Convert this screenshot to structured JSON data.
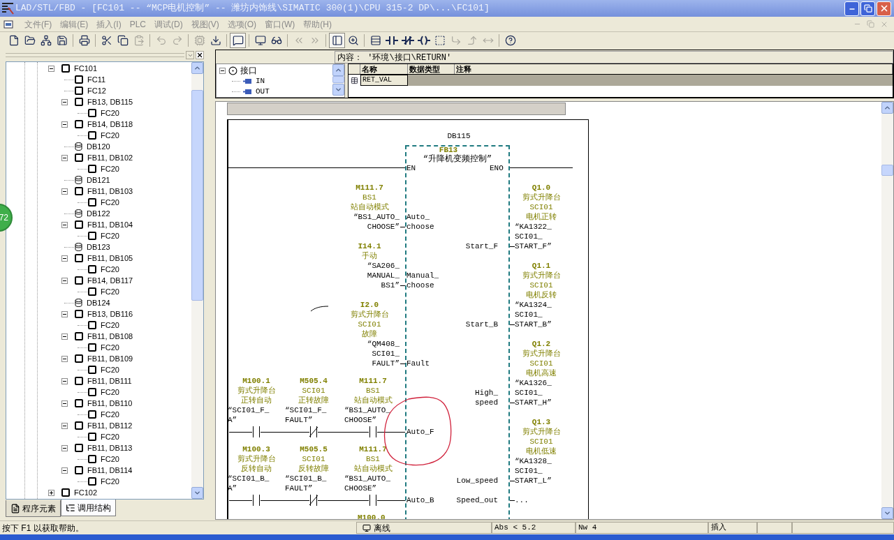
{
  "window": {
    "title": "LAD/STL/FBD  - [FC101 -- “MCP电机控制” -- 潍坊内饰线\\SIMATIC 300(1)\\CPU 315-2 DP\\...\\FC101]"
  },
  "menu": [
    "文件(F)",
    "编辑(E)",
    "插入(I)",
    "PLC",
    "调试(D)",
    "视图(V)",
    "选项(O)",
    "窗口(W)",
    "帮助(H)"
  ],
  "toolbar": [
    [
      {
        "kind": "new",
        "disabled": false,
        "pressed": false
      },
      {
        "kind": "open",
        "disabled": false,
        "pressed": false
      },
      {
        "kind": "nodes",
        "disabled": false,
        "pressed": false
      },
      {
        "kind": "save",
        "disabled": false,
        "pressed": false
      }
    ],
    [
      {
        "kind": "print",
        "disabled": false,
        "pressed": false
      }
    ],
    [
      {
        "kind": "cut",
        "disabled": false,
        "pressed": false
      },
      {
        "kind": "copy",
        "disabled": false,
        "pressed": false
      },
      {
        "kind": "paste",
        "disabled": true,
        "pressed": false
      }
    ],
    [
      {
        "kind": "undo",
        "disabled": true,
        "pressed": false
      },
      {
        "kind": "redo",
        "disabled": true,
        "pressed": false
      }
    ],
    [
      {
        "kind": "compile",
        "disabled": true,
        "pressed": false
      },
      {
        "kind": "download",
        "disabled": false,
        "pressed": false
      }
    ],
    [
      {
        "kind": "overview",
        "disabled": false,
        "pressed": true
      }
    ],
    [
      {
        "kind": "monitor",
        "disabled": false,
        "pressed": false
      },
      {
        "kind": "glasses",
        "disabled": false,
        "pressed": false
      }
    ],
    [
      {
        "kind": "prev",
        "disabled": true,
        "pressed": false
      },
      {
        "kind": "next",
        "disabled": true,
        "pressed": false
      }
    ],
    [
      {
        "kind": "panel",
        "disabled": false,
        "pressed": true
      },
      {
        "kind": "zoom",
        "disabled": false,
        "pressed": false
      }
    ],
    [
      {
        "kind": "network",
        "disabled": false,
        "pressed": false
      },
      {
        "kind": "no",
        "disabled": false,
        "pressed": false
      },
      {
        "kind": "nc",
        "disabled": false,
        "pressed": false
      },
      {
        "kind": "coil",
        "disabled": false,
        "pressed": false
      },
      {
        "kind": "box",
        "disabled": false,
        "pressed": false
      },
      {
        "kind": "branch-open",
        "disabled": true,
        "pressed": false
      },
      {
        "kind": "branch-close",
        "disabled": true,
        "pressed": false
      },
      {
        "kind": "branch-span",
        "disabled": true,
        "pressed": false
      }
    ],
    [
      {
        "kind": "help",
        "disabled": false,
        "pressed": false
      }
    ]
  ],
  "call_tree": [
    {
      "label": "FC101",
      "kind": "block",
      "expanded": true,
      "children": [
        {
          "label": "FC11",
          "kind": "block"
        },
        {
          "label": "FC12",
          "kind": "block"
        },
        {
          "label": "FB13, DB115",
          "kind": "block",
          "expanded": true,
          "children": [
            {
              "label": "FC20",
              "kind": "block"
            }
          ]
        },
        {
          "label": "FB14, DB118",
          "kind": "block",
          "expanded": true,
          "children": [
            {
              "label": "FC20",
              "kind": "block"
            }
          ]
        },
        {
          "label": "DB120",
          "kind": "db"
        },
        {
          "label": "FB11, DB102",
          "kind": "block",
          "expanded": true,
          "children": [
            {
              "label": "FC20",
              "kind": "block"
            }
          ]
        },
        {
          "label": "DB121",
          "kind": "db"
        },
        {
          "label": "FB11, DB103",
          "kind": "block",
          "expanded": true,
          "children": [
            {
              "label": "FC20",
              "kind": "block"
            }
          ]
        },
        {
          "label": "DB122",
          "kind": "db"
        },
        {
          "label": "FB11, DB104",
          "kind": "block",
          "expanded": true,
          "children": [
            {
              "label": "FC20",
              "kind": "block"
            }
          ]
        },
        {
          "label": "DB123",
          "kind": "db"
        },
        {
          "label": "FB11, DB105",
          "kind": "block",
          "expanded": true,
          "children": [
            {
              "label": "FC20",
              "kind": "block"
            }
          ]
        },
        {
          "label": "FB14, DB117",
          "kind": "block",
          "expanded": true,
          "children": [
            {
              "label": "FC20",
              "kind": "block"
            }
          ]
        },
        {
          "label": "DB124",
          "kind": "db"
        },
        {
          "label": "FB13, DB116",
          "kind": "block",
          "expanded": true,
          "children": [
            {
              "label": "FC20",
              "kind": "block"
            }
          ]
        },
        {
          "label": "FB11, DB108",
          "kind": "block",
          "expanded": true,
          "children": [
            {
              "label": "FC20",
              "kind": "block"
            }
          ]
        },
        {
          "label": "FB11, DB109",
          "kind": "block",
          "expanded": true,
          "children": [
            {
              "label": "FC20",
              "kind": "block"
            }
          ]
        },
        {
          "label": "FB11, DB111",
          "kind": "block",
          "expanded": true,
          "children": [
            {
              "label": "FC20",
              "kind": "block"
            }
          ]
        },
        {
          "label": "FB11, DB110",
          "kind": "block",
          "expanded": true,
          "children": [
            {
              "label": "FC20",
              "kind": "block"
            }
          ]
        },
        {
          "label": "FB11, DB112",
          "kind": "block",
          "expanded": true,
          "children": [
            {
              "label": "FC20",
              "kind": "block"
            }
          ]
        },
        {
          "label": "FB11, DB113",
          "kind": "block",
          "expanded": true,
          "children": [
            {
              "label": "FC20",
              "kind": "block"
            }
          ]
        },
        {
          "label": "FB11, DB114",
          "kind": "block",
          "expanded": true,
          "children": [
            {
              "label": "FC20",
              "kind": "block"
            }
          ]
        }
      ]
    },
    {
      "label": "FC102",
      "kind": "block",
      "expanded": false
    }
  ],
  "left_tabs": [
    {
      "label": "程序元素",
      "selected": false
    },
    {
      "label": "调用结构",
      "selected": true
    }
  ],
  "floating_badge": "72",
  "interface": {
    "content": "内容： '环境\\接口\\RETURN'",
    "tree": {
      "label": "接口",
      "expanded": true,
      "children": [
        "IN",
        "OUT"
      ]
    },
    "columns": [
      "名称",
      "数据类型",
      "注释"
    ],
    "rows": [
      [
        "RET_VAL"
      ]
    ]
  },
  "network": {
    "instance": "DB115",
    "block": "FB13",
    "block_name": "“升降机变频控制”",
    "en": "EN",
    "eno": "ENO",
    "inputs": [
      {
        "pin": [
          "Auto_",
          "choose"
        ],
        "address": "M111.7",
        "comment": [
          "BS1",
          "站自动模式"
        ],
        "symbol": [
          "“BS1_AUTO_",
          "CHOOSE”"
        ]
      },
      {
        "pin": [
          "Manual_",
          "choose"
        ],
        "address": "I14.1",
        "comment": [
          "手动"
        ],
        "symbol": [
          "“SA206_",
          "MANUAL_",
          "BS1”"
        ]
      },
      {
        "pin": [
          "Fault"
        ],
        "address": "I2.0",
        "comment": [
          "剪式升降台",
          "SCI01",
          "故障"
        ],
        "symbol": [
          "“QM408_",
          "SCI01_",
          "FAULT”"
        ]
      }
    ],
    "contact_rows": [
      {
        "pin": "Auto_F",
        "contacts": [
          {
            "kind": "no",
            "address": "M100.1",
            "comment": [
              "剪式升降台",
              "正转自动"
            ],
            "symbol": [
              "“SCI01_F_",
              "A”"
            ]
          },
          {
            "kind": "nc",
            "address": "M505.4",
            "comment": [
              "SCI01",
              "正转故障"
            ],
            "symbol": [
              "“SCI01_F_",
              "FAULT”"
            ]
          },
          {
            "kind": "no",
            "address": "M111.7",
            "comment": [
              "BS1",
              "站自动模式"
            ],
            "symbol": [
              "“BS1_AUTO_",
              "CHOOSE”"
            ]
          }
        ]
      },
      {
        "pin": "Auto_B",
        "contacts": [
          {
            "kind": "no",
            "address": "M100.3",
            "comment": [
              "剪式升降台",
              "反转自动"
            ],
            "symbol": [
              "“SCI01_B_",
              "A”"
            ]
          },
          {
            "kind": "nc",
            "address": "M505.5",
            "comment": [
              "SCI01",
              "反转故障"
            ],
            "symbol": [
              "“SCI01_B_",
              "FAULT”"
            ]
          },
          {
            "kind": "no",
            "address": "M111.7",
            "comment": [
              "BS1",
              "站自动模式"
            ],
            "symbol": [
              "“BS1_AUTO_",
              "CHOOSE”"
            ]
          }
        ]
      }
    ],
    "next_address": "M100.0",
    "outputs": [
      {
        "pin": [
          "Start_F"
        ],
        "address": "Q1.0",
        "comment": [
          "剪式升降台",
          "SCI01",
          "电机正转"
        ],
        "symbol": [
          "“KA1322_",
          "SCI01_",
          "START_F”"
        ]
      },
      {
        "pin": [
          "Start_B"
        ],
        "address": "Q1.1",
        "comment": [
          "剪式升降台",
          "SCI01",
          "电机反转"
        ],
        "symbol": [
          "“KA1324_",
          "SCI01_",
          "START_B”"
        ]
      },
      {
        "pin": [
          "High_",
          "speed"
        ],
        "address": "Q1.2",
        "comment": [
          "剪式升降台",
          "SCI01",
          "电机高速"
        ],
        "symbol": [
          "“KA1326_",
          "SCI01_",
          "START_H”"
        ]
      },
      {
        "pin": [
          "Low_speed"
        ],
        "address": "Q1.3",
        "comment": [
          "剪式升降台",
          "SCI01",
          "电机低速"
        ],
        "symbol": [
          "“KA1328_",
          "SCI01_",
          "START_L”"
        ]
      },
      {
        "pin": [
          "Speed_out"
        ],
        "symbol": [
          "..."
        ]
      }
    ]
  },
  "status_bar": {
    "help": "按下 F1 以获取帮助。",
    "connection": "离线",
    "panes": [
      "Abs < 5.2",
      "Nw 4",
      "插入"
    ]
  }
}
